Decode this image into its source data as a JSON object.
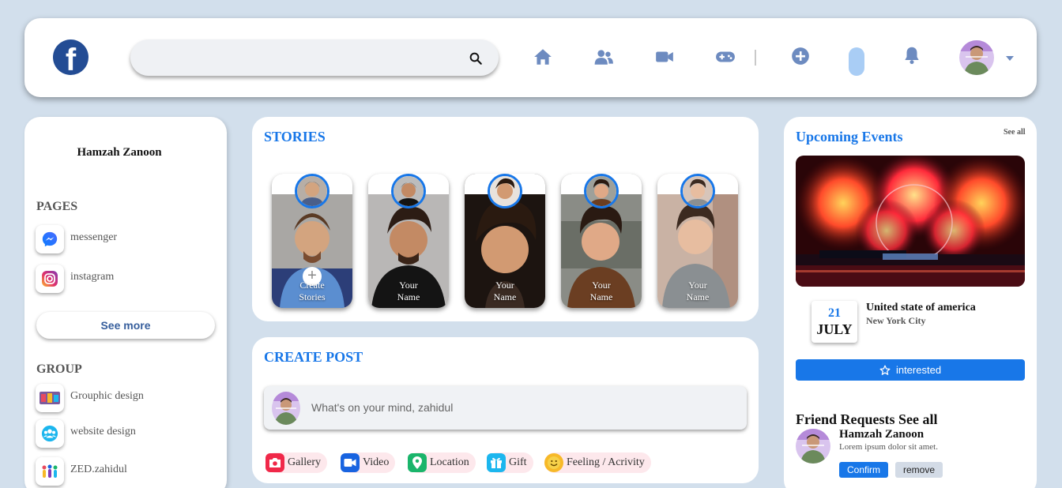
{
  "header": {
    "logo_letter": "f",
    "search": {
      "value": "",
      "placeholder": ""
    },
    "nav_icons": [
      "home-icon",
      "friends-icon",
      "video-icon",
      "gaming-icon",
      "add-icon",
      "bell-icon"
    ]
  },
  "left": {
    "profile_name": "Hamzah Zanoon",
    "pages_title": "PAGES",
    "pages": [
      {
        "label": "messenger",
        "icon": "messenger-icon"
      },
      {
        "label": "instagram",
        "icon": "instagram-icon"
      }
    ],
    "see_more": "See more",
    "group_title": "GROUP",
    "groups": [
      {
        "label": "Grouphic design"
      },
      {
        "label": "website design"
      },
      {
        "label": "ZED.zahidul"
      }
    ]
  },
  "stories": {
    "title": "STORIES",
    "items": [
      {
        "line1": "Create",
        "line2": "Stories"
      },
      {
        "line1": "Your",
        "line2": "Name"
      },
      {
        "line1": "Your",
        "line2": "Name"
      },
      {
        "line1": "Your",
        "line2": "Name"
      },
      {
        "line1": "Your",
        "line2": "Name"
      }
    ]
  },
  "create_post": {
    "title": "CREATE POST",
    "placeholder": "What's on your mind, zahidul",
    "actions": [
      {
        "label": "Gallery",
        "color": "#f02849"
      },
      {
        "label": "Video",
        "color": "#1863e0"
      },
      {
        "label": "Location",
        "color": "#1ab56b"
      },
      {
        "label": "Gift",
        "color": "#1cb6ee"
      },
      {
        "label": "Feeling / Acrivity",
        "color": "#f7b928"
      }
    ]
  },
  "events": {
    "title": "Upcoming Events",
    "see_all": "See all",
    "day": "21",
    "month": "JULY",
    "place": "United state of america",
    "city": "New York City",
    "interested_label": "interested"
  },
  "friend_requests": {
    "title": "Friend Requests See all",
    "name": "Hamzah Zanoon",
    "text": "Lorem ipsum dolor sit amet.",
    "confirm": "Confirm",
    "remove": "remove"
  },
  "colors": {
    "accent": "#1877e8",
    "background": "#d2dfec",
    "nav_icon": "#6d8bc0"
  }
}
